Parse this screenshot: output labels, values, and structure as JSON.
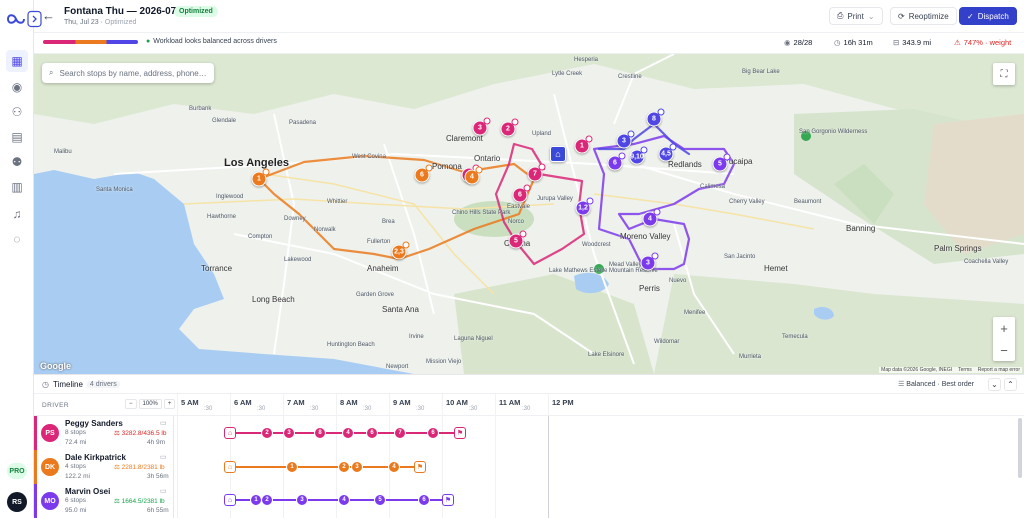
{
  "header": {
    "title": "Fontana Thu — 2026-07-23",
    "status": "Optimized",
    "date": "Thu, Jul 23",
    "sub_status": "Optimized",
    "print_label": "Print",
    "reoptimize_label": "Reoptimize",
    "dispatch_label": "Dispatch"
  },
  "stats": {
    "balance_message": "Workload looks balanced across drivers",
    "stops": "28/28",
    "duration": "16h 31m",
    "distance": "343.9 mi",
    "capacity_warning": "747% · weight"
  },
  "map": {
    "search_placeholder": "Search stops by name, address, phone…",
    "google": "Google",
    "attribution": "Map data ©2026 Google, INEGI",
    "terms": "Terms",
    "report": "Report a map error",
    "zoom_in": "+",
    "zoom_out": "−",
    "places": {
      "la": "Los Angeles",
      "lb": "Long Beach",
      "anaheim": "Anaheim",
      "pomona": "Pomona",
      "ontario": "Ontario",
      "glendale": "Glendale",
      "pasadena": "Pasadena",
      "burbank": "Burbank",
      "santaana": "Santa Ana",
      "irvine": "Irvine",
      "riverside": "Riverside",
      "moreno": "Moreno Valley",
      "perris": "Perris",
      "temecula": "Temecula",
      "hemet": "Hemet",
      "torrance": "Torrance",
      "whittier": "Whittier",
      "downey": "Downey",
      "fullerton": "Fullerton",
      "corona": "Corona",
      "eastvale": "Eastvale",
      "chino": "Chino Hills State Park",
      "redlands": "Redlands",
      "yucaipa": "Yucaipa",
      "beaumont": "Beaumont",
      "banning": "Banning",
      "palmsprings": "Palm Springs",
      "coachella": "Coachella Valley",
      "elsinore": "Lake Elsinore",
      "hb": "Huntington Beach",
      "newport": "Newport",
      "malibu": "Malibu",
      "santamonica": "Santa Monica",
      "westcovina": "West Covina",
      "claremont": "Claremont",
      "upland": "Upland",
      "hesperia": "Hesperia",
      "lytle": "Lytle Creek",
      "crestline": "Crestline",
      "bigbear": "Big Bear Lake",
      "norco": "Norco",
      "menifee": "Menifee",
      "murrieta": "Murrieta",
      "wildomar": "Wildomar",
      "mission": "Mission Viejo",
      "laguna": "Laguna Niguel",
      "calimesa": "Calimesa",
      "mead": "Mead Valley",
      "nuevo": "Nuevo",
      "woodcrest": "Woodcrest",
      "lakewood": "Lakewood",
      "inglewood": "Inglewood",
      "compton": "Compton",
      "norwalk": "Norwalk",
      "hawthorne": "Hawthorne",
      "brea": "Brea",
      "lakeview": "Lake Mathews Estelle Mountain Reserve",
      "jurupa": "Jurupa Valley",
      "sanjacinto": "San Jacinto",
      "cherry": "Cherry Valley",
      "sangorgonio": "San Gorgonio Wilderness",
      "gardengrove": "Garden Grove"
    },
    "pins": [
      {
        "label": "3",
        "color": "#db2777"
      },
      {
        "label": "2",
        "color": "#db2777"
      },
      {
        "label": "1",
        "color": "#db2777"
      },
      {
        "label": "4",
        "color": "#db2777"
      },
      {
        "label": "6",
        "color": "#db2777"
      },
      {
        "label": "5",
        "color": "#db2777"
      },
      {
        "label": "7",
        "color": "#db2777"
      },
      {
        "label": "1",
        "color": "#ea7a1d"
      },
      {
        "label": "6",
        "color": "#ea7a1d"
      },
      {
        "label": "4",
        "color": "#ea7a1d"
      },
      {
        "label": "2,3",
        "color": "#ea7a1d"
      },
      {
        "label": "8",
        "color": "#4f46e5"
      },
      {
        "label": "3",
        "color": "#4f46e5"
      },
      {
        "label": "9,10",
        "color": "#4f46e5"
      },
      {
        "label": "4,5",
        "color": "#4f46e5"
      },
      {
        "label": "6",
        "color": "#7c3aed"
      },
      {
        "label": "5",
        "color": "#7c3aed"
      },
      {
        "label": "1,2",
        "color": "#7c3aed"
      },
      {
        "label": "4",
        "color": "#7c3aed"
      },
      {
        "label": "3",
        "color": "#7c3aed"
      }
    ]
  },
  "timeline": {
    "title": "Timeline",
    "count": "4 drivers",
    "sort": "Balanced · Best order",
    "driver_header": "DRIVER",
    "zoom_minus": "−",
    "zoom_value": "100%",
    "zoom_plus": "+",
    "hours": [
      "5 AM",
      "6 AM",
      "7 AM",
      "8 AM",
      "9 AM",
      "10 AM",
      "11 AM",
      "12 PM"
    ],
    "half": ":30",
    "drivers": [
      {
        "initials": "PS",
        "name": "Peggy Sanders",
        "stops": "8 stops",
        "miles": "72.4 mi",
        "weight": "3282.8/436.5 lb",
        "time": "4h 9m",
        "color": "#db2777",
        "weight_color": "#dc2626",
        "labels": [
          "2",
          "3",
          "8",
          "4",
          "6",
          "7",
          "6"
        ]
      },
      {
        "initials": "DK",
        "name": "Dale Kirkpatrick",
        "stops": "4 stops",
        "miles": "122.2 mi",
        "weight": "2281.8/2381 lb",
        "time": "3h 56m",
        "color": "#ea7a1d",
        "weight_color": "#ea7a1d",
        "labels": [
          "1",
          "2",
          "3",
          "4"
        ]
      },
      {
        "initials": "MO",
        "name": "Marvin Osei",
        "stops": "6 stops",
        "miles": "95.0 mi",
        "weight": "1664.5/2381 lb",
        "time": "6h 55m",
        "color": "#7c3aed",
        "weight_color": "#16a34a",
        "labels": [
          "1",
          "2",
          "3",
          "4",
          "5",
          "6"
        ]
      }
    ]
  },
  "sidebar": {
    "pro": "PRO",
    "user": "RS"
  },
  "colors": {
    "primary": "#3340c9",
    "route_red": "#db2777",
    "route_orange": "#ea7a1d",
    "route_purple": "#7c3aed",
    "route_blue": "#4f46e5"
  }
}
